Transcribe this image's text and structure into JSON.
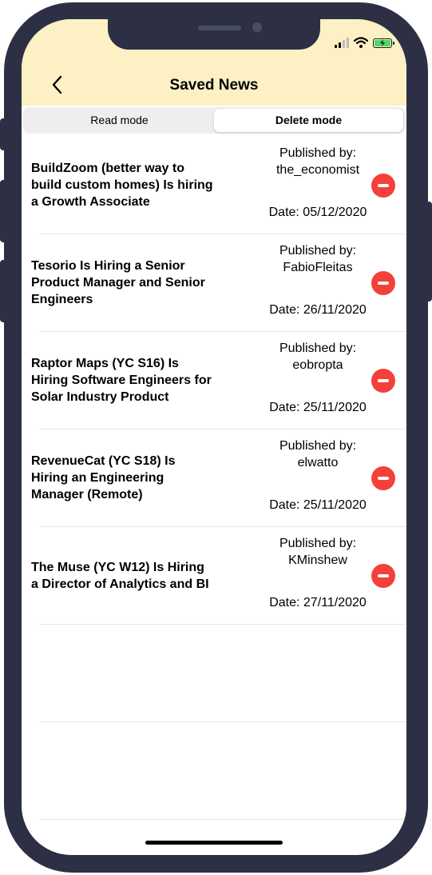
{
  "header": {
    "title": "Saved News",
    "back_icon": "chevron-left-icon"
  },
  "segments": [
    {
      "label": "Read mode",
      "active": false
    },
    {
      "label": "Delete mode",
      "active": true
    }
  ],
  "articles": [
    {
      "headline": "BuildZoom (better way to build custom homes) Is hiring a Growth Associate",
      "published_label": "Published by:",
      "author": "the_economist",
      "date": "Date: 05/12/2020"
    },
    {
      "headline": "Tesorio Is Hiring a Senior Product Manager and Senior Engineers",
      "published_label": "Published by:",
      "author": "FabioFleitas",
      "date": "Date: 26/11/2020"
    },
    {
      "headline": "Raptor Maps (YC S16) Is Hiring Software Engineers for Solar Industry Product",
      "published_label": "Published by:",
      "author": "eobropta",
      "date": "Date: 25/11/2020"
    },
    {
      "headline": "RevenueCat (YC S18) Is Hiring an Engineering Manager (Remote)",
      "published_label": "Published by:",
      "author": "elwatto",
      "date": "Date: 25/11/2020"
    },
    {
      "headline": "The Muse (YC W12) Is Hiring a Director of Analytics and BI",
      "published_label": "Published by:",
      "author": "KMinshew",
      "date": "Date: 27/11/2020"
    }
  ],
  "colors": {
    "header_bg": "#fcf0c4",
    "delete": "#f4403a",
    "frame": "#2d2f45"
  }
}
